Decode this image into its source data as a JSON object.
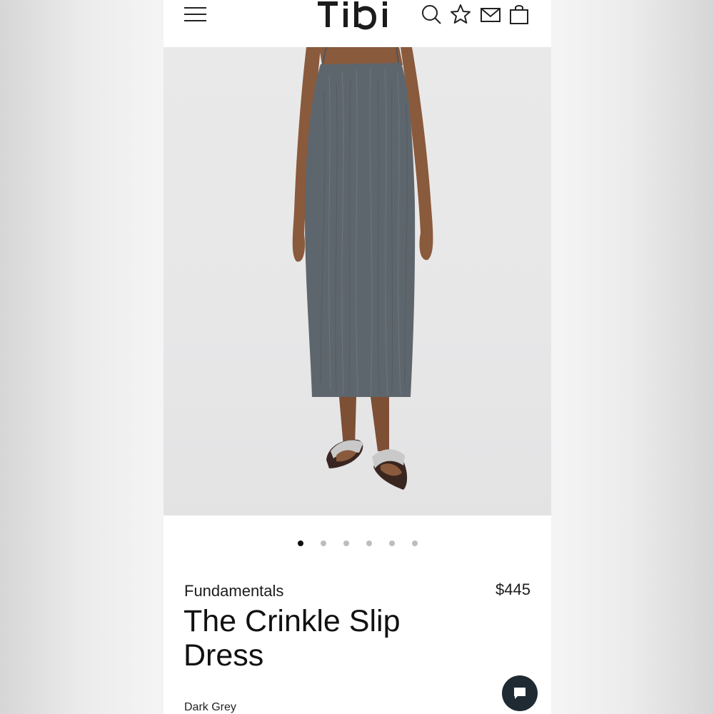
{
  "brand": {
    "name": "TIBI"
  },
  "header": {
    "icons": [
      "menu-icon",
      "search-icon",
      "star-icon",
      "mail-icon",
      "bag-icon"
    ]
  },
  "gallery": {
    "slide_count": 6,
    "active_index": 0
  },
  "product": {
    "collection": "Fundamentals",
    "price": "$445",
    "title": "The Crinkle Slip Dress",
    "color": "Dark Grey"
  },
  "chat": {
    "icon": "chat-icon"
  },
  "colors": {
    "dress": "#5e666d",
    "background": "#e8e8e8",
    "chat_button": "#1f2a33"
  }
}
